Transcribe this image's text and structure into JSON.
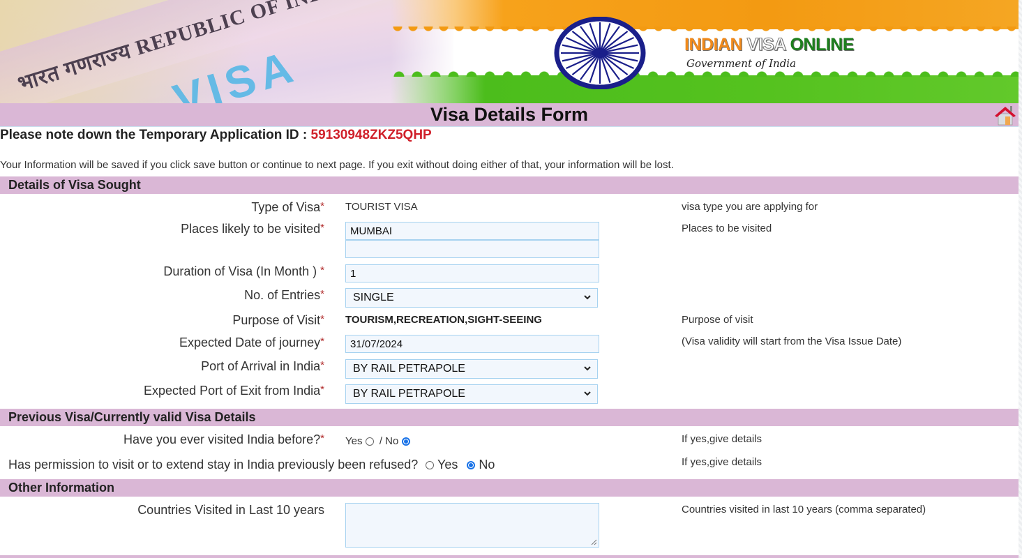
{
  "banner": {
    "passport_text": "भारत गणराज्य REPUBLIC OF INDIA",
    "passport_visa": "VISA",
    "brand_part1": "INDIAN",
    "brand_part2": "VISA",
    "brand_part3": "ONLINE",
    "subtitle": "Government of India"
  },
  "header": {
    "title": "Visa Details Form",
    "home_icon": "home-icon"
  },
  "application": {
    "id_label": "Please note down the Temporary Application ID :",
    "id_value": "59130948ZKZ5QHP",
    "notice": "Your Information will be saved if you click save button or continue to next page. If you exit without doing either of that, your information will be lost."
  },
  "colors": {
    "section_bg": "#dab7d6",
    "id_red": "#d0202a",
    "input_border": "#a6d2f0",
    "input_bg": "#f2f7fd",
    "radio_blue": "#1a73e8"
  },
  "sections": {
    "visa_sought": {
      "title": "Details of Visa Sought",
      "type_of_visa": {
        "label": "Type of Visa",
        "value": "TOURIST VISA",
        "hint": "visa type you are applying for"
      },
      "places": {
        "label": "Places likely to be visited",
        "value1": "MUMBAI",
        "value2": "",
        "hint": "Places to be visited"
      },
      "duration": {
        "label": "Duration of Visa (In Month ) ",
        "value": "1"
      },
      "entries": {
        "label": "No. of Entries",
        "value": "SINGLE"
      },
      "purpose": {
        "label": "Purpose of Visit",
        "value": "TOURISM,RECREATION,SIGHT-SEEING",
        "hint": "Purpose of visit"
      },
      "journey_date": {
        "label": "Expected Date of journey",
        "value": "31/07/2024",
        "hint": "(Visa validity will start from the Visa Issue Date)"
      },
      "port_arrival": {
        "label": "Port of Arrival in India",
        "value": "BY RAIL PETRAPOLE"
      },
      "port_exit": {
        "label": "Expected Port of Exit from India",
        "value": "BY RAIL PETRAPOLE"
      },
      "required_mark": "*"
    },
    "previous_visa": {
      "title": "Previous Visa/Currently valid Visa Details",
      "visited_before": {
        "label": "Have you ever visited India before?",
        "yes": "Yes",
        "no": "/ No",
        "selected": "No",
        "hint": "If yes,give details"
      },
      "refused": {
        "label": "Has permission to visit or to extend stay in India previously been refused?",
        "yes": "Yes",
        "no": "No",
        "selected": "No",
        "hint": "If yes,give details"
      }
    },
    "other_info": {
      "title": "Other Information",
      "countries": {
        "label": "Countries Visited in Last 10 years",
        "value": "",
        "hint": "Countries visited in last 10 years (comma separated)"
      }
    }
  }
}
